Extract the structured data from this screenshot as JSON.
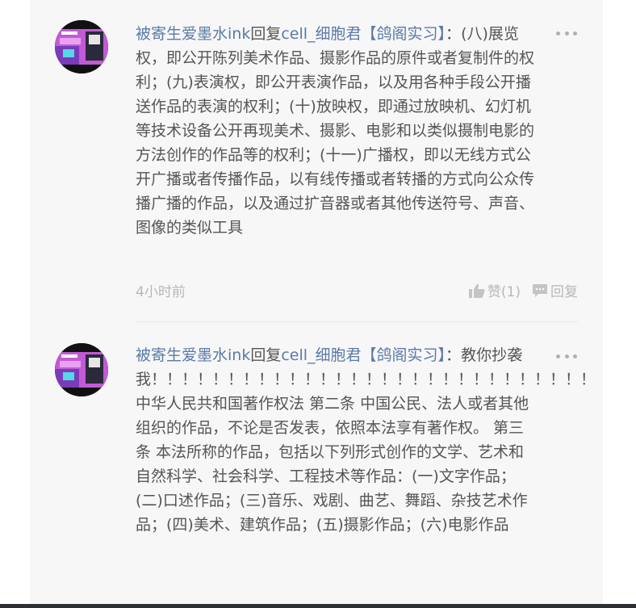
{
  "comments": [
    {
      "author": "被寄生爱墨水ink",
      "reply_word": "回复",
      "target": "cell_细胞君【鸽阁实习】",
      "colon": "：",
      "text": "(八)展览权，即公开陈列美术作品、摄影作品的原件或者复制件的权利；(九)表演权，即公开表演作品，以及用各种手段公开播送作品的表演的权利；(十)放映权，即通过放映机、幻灯机等技术设备公开再现美术、摄影、电影和以类似摄制电影的方法创作的作品等的权利；(十一)广播权，即以无线方式公开广播或者传播作品，以有线传播或者转播的方式向公众传播广播的作品，以及通过扩音器或者其他传送符号、声音、图像的类似工具",
      "time": "4小时前",
      "like_label": "赞(1)",
      "reply_label": "回复"
    },
    {
      "author": "被寄生爱墨水ink",
      "reply_word": "回复",
      "target": "cell_细胞君【鸽阁实习】",
      "colon": "：",
      "text": "教你抄袭我！！！！！！！！！！！！！！！！！！！！！！！！！！！！！ 中华人民共和国著作权法 第二条 中国公民、法人或者其他组织的作品，不论是否发表，依照本法享有著作权。 第三条 本法所称的作品，包括以下列形式创作的文学、艺术和自然科学、社会科学、工程技术等作品：(一)文字作品；(二)口述作品；(三)音乐、戏剧、曲艺、舞蹈、杂技艺术作品；(四)美术、建筑作品；(五)摄影作品；(六)电影作品"
    }
  ],
  "colors": {
    "username": "#5b7aa6",
    "text": "#555555",
    "meta": "#b8b8b8",
    "panel": "#f7f7f8"
  },
  "icons": {
    "like": "thumb-up-icon",
    "reply": "chat-bubble-icon",
    "more": "more-dots-icon"
  }
}
